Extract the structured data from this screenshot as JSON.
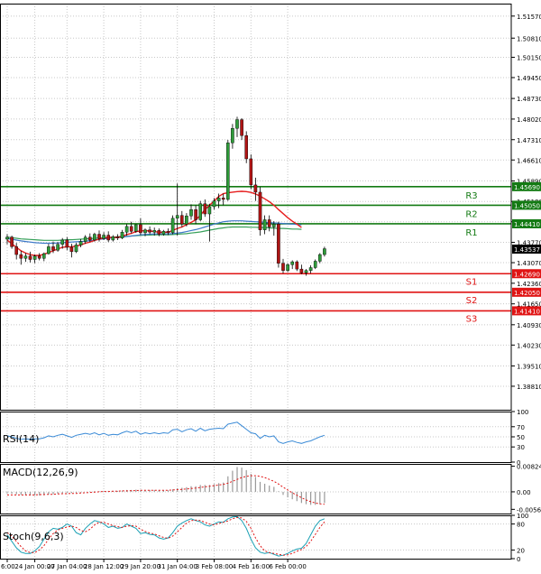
{
  "colors": {
    "background": "#ffffff",
    "grid": "#c8c8c8",
    "frame": "#000000",
    "candle_up": "#2e9c3a",
    "candle_down": "#b01414",
    "ma_fast": "#e61e1e",
    "ma_mid": "#3c78c8",
    "ma_slow": "#37a05a",
    "resistance": "#137a13",
    "support": "#e01414",
    "rsi_line": "#3a8ad6",
    "macd_hist": "#9a9a9a",
    "macd_signal": "#e01414",
    "stoch_main": "#1aa0b4",
    "stoch_signal": "#e01414",
    "price_tag": "#000000"
  },
  "chart_data": [
    {
      "type": "candlestick",
      "panel": "price",
      "ylim": [
        1.38,
        1.52
      ],
      "yticks": [
        "1.51570",
        "1.50810",
        "1.50150",
        "1.49450",
        "1.48730",
        "1.48020",
        "1.47310",
        "1.46610",
        "1.45890",
        "1.45180",
        "1.44480",
        "1.43770",
        "1.43070",
        "1.42360",
        "1.41650",
        "1.40930",
        "1.40230",
        "1.39510",
        "1.38810"
      ],
      "current_price": "1.43537",
      "candles": [
        [
          1.4388,
          1.4405,
          1.437,
          1.4395
        ],
        [
          1.4395,
          1.44,
          1.4355,
          1.4362
        ],
        [
          1.4362,
          1.4375,
          1.4318,
          1.4335
        ],
        [
          1.4335,
          1.4348,
          1.43,
          1.4322
        ],
        [
          1.4322,
          1.434,
          1.431,
          1.433
        ],
        [
          1.433,
          1.4345,
          1.4308,
          1.4318
        ],
        [
          1.4318,
          1.4335,
          1.4305,
          1.433
        ],
        [
          1.433,
          1.434,
          1.4315,
          1.4322
        ],
        [
          1.4322,
          1.4342,
          1.4312,
          1.4338
        ],
        [
          1.4338,
          1.4372,
          1.4335,
          1.4362
        ],
        [
          1.4362,
          1.438,
          1.434,
          1.435
        ],
        [
          1.435,
          1.4378,
          1.4345,
          1.437
        ],
        [
          1.437,
          1.4392,
          1.4355,
          1.4385
        ],
        [
          1.4385,
          1.4395,
          1.435,
          1.436
        ],
        [
          1.436,
          1.4372,
          1.4325,
          1.4345
        ],
        [
          1.4345,
          1.4375,
          1.434,
          1.4368
        ],
        [
          1.4368,
          1.4388,
          1.436,
          1.438
        ],
        [
          1.438,
          1.4402,
          1.4372,
          1.4395
        ],
        [
          1.4395,
          1.4408,
          1.4378,
          1.4385
        ],
        [
          1.4385,
          1.441,
          1.438,
          1.4405
        ],
        [
          1.4405,
          1.4418,
          1.438,
          1.439
        ],
        [
          1.439,
          1.4412,
          1.4385,
          1.4402
        ],
        [
          1.4402,
          1.4415,
          1.4378,
          1.4385
        ],
        [
          1.4385,
          1.4402,
          1.438,
          1.4396
        ],
        [
          1.4396,
          1.4405,
          1.4385,
          1.4392
        ],
        [
          1.4392,
          1.442,
          1.4388,
          1.4412
        ],
        [
          1.4412,
          1.444,
          1.44,
          1.4432
        ],
        [
          1.4432,
          1.4448,
          1.4408,
          1.4415
        ],
        [
          1.4415,
          1.444,
          1.441,
          1.4438
        ],
        [
          1.4438,
          1.446,
          1.4402,
          1.441
        ],
        [
          1.441,
          1.4425,
          1.4398,
          1.442
        ],
        [
          1.442,
          1.4432,
          1.4405,
          1.4412
        ],
        [
          1.4412,
          1.4428,
          1.44,
          1.4418
        ],
        [
          1.4418,
          1.4425,
          1.4398,
          1.4405
        ],
        [
          1.4405,
          1.442,
          1.44,
          1.4415
        ],
        [
          1.4415,
          1.4425,
          1.4402,
          1.441
        ],
        [
          1.441,
          1.447,
          1.4405,
          1.446
        ],
        [
          1.446,
          1.458,
          1.44,
          1.447
        ],
        [
          1.447,
          1.4485,
          1.443,
          1.444
        ],
        [
          1.444,
          1.4478,
          1.4432,
          1.4468
        ],
        [
          1.4468,
          1.4508,
          1.4455,
          1.449
        ],
        [
          1.449,
          1.4505,
          1.444,
          1.4455
        ],
        [
          1.4455,
          1.452,
          1.445,
          1.451
        ],
        [
          1.451,
          1.4525,
          1.4465,
          1.4475
        ],
        [
          1.4475,
          1.451,
          1.438,
          1.45
        ],
        [
          1.45,
          1.453,
          1.449,
          1.452
        ],
        [
          1.452,
          1.4545,
          1.4495,
          1.453
        ],
        [
          1.453,
          1.4545,
          1.4505,
          1.4525
        ],
        [
          1.4525,
          1.473,
          1.452,
          1.472
        ],
        [
          1.472,
          1.4785,
          1.47,
          1.477
        ],
        [
          1.477,
          1.481,
          1.474,
          1.48
        ],
        [
          1.48,
          1.4805,
          1.473,
          1.4745
        ],
        [
          1.4745,
          1.476,
          1.465,
          1.4665
        ],
        [
          1.4665,
          1.468,
          1.456,
          1.4575
        ],
        [
          1.4575,
          1.46,
          1.452,
          1.455
        ],
        [
          1.455,
          1.4568,
          1.44,
          1.442
        ],
        [
          1.442,
          1.447,
          1.4405,
          1.4455
        ],
        [
          1.4455,
          1.447,
          1.4415,
          1.443
        ],
        [
          1.443,
          1.445,
          1.44,
          1.444
        ],
        [
          1.444,
          1.4448,
          1.429,
          1.4305
        ],
        [
          1.4305,
          1.432,
          1.427,
          1.428
        ],
        [
          1.428,
          1.4305,
          1.4275,
          1.43
        ],
        [
          1.43,
          1.4315,
          1.4285,
          1.431
        ],
        [
          1.431,
          1.4315,
          1.4278,
          1.4285
        ],
        [
          1.4285,
          1.43,
          1.4268,
          1.4272
        ],
        [
          1.4272,
          1.4285,
          1.4262,
          1.428
        ],
        [
          1.428,
          1.4298,
          1.427,
          1.429
        ],
        [
          1.429,
          1.4318,
          1.4285,
          1.4312
        ],
        [
          1.4312,
          1.434,
          1.4305,
          1.4335
        ],
        [
          1.4335,
          1.4362,
          1.4328,
          1.4355
        ]
      ],
      "ma_fast": [
        1.4385,
        1.4372,
        1.436,
        1.4348,
        1.434,
        1.4335,
        1.4332,
        1.4332,
        1.4336,
        1.4342,
        1.4348,
        1.4354,
        1.436,
        1.4362,
        1.4362,
        1.4364,
        1.4368,
        1.4374,
        1.4378,
        1.4384,
        1.4388,
        1.4392,
        1.4394,
        1.4394,
        1.4394,
        1.4398,
        1.4404,
        1.4408,
        1.4414,
        1.4416,
        1.4418,
        1.4416,
        1.4414,
        1.4412,
        1.4412,
        1.4412,
        1.4418,
        1.4425,
        1.443,
        1.4438,
        1.4446,
        1.4455,
        1.447,
        1.449,
        1.4505,
        1.452,
        1.4535,
        1.4545,
        1.4548,
        1.455,
        1.4552,
        1.4553,
        1.4552,
        1.4549,
        1.4544,
        1.4536,
        1.4527,
        1.4517,
        1.4505,
        1.449,
        1.4476,
        1.4462,
        1.445,
        1.444,
        1.4428
      ],
      "ma_mid": [
        1.439,
        1.4388,
        1.4385,
        1.4382,
        1.438,
        1.4378,
        1.4376,
        1.4375,
        1.4374,
        1.4374,
        1.4374,
        1.4375,
        1.4376,
        1.4377,
        1.4378,
        1.4379,
        1.438,
        1.4381,
        1.4383,
        1.4385,
        1.4387,
        1.4389,
        1.4391,
        1.4393,
        1.4394,
        1.4395,
        1.4397,
        1.4399,
        1.4401,
        1.4403,
        1.4404,
        1.4405,
        1.4406,
        1.4406,
        1.4406,
        1.4406,
        1.4407,
        1.4409,
        1.4411,
        1.4414,
        1.4418,
        1.4421,
        1.4425,
        1.443,
        1.4435,
        1.444,
        1.4444,
        1.4448,
        1.445,
        1.4451,
        1.4451,
        1.4451,
        1.445,
        1.4449,
        1.4448,
        1.4447,
        1.4446,
        1.4445,
        1.4444,
        1.4443,
        1.4442,
        1.4441,
        1.444,
        1.4439,
        1.4437
      ],
      "ma_slow": [
        1.4395,
        1.4393,
        1.4391,
        1.4389,
        1.4388,
        1.4387,
        1.4386,
        1.4385,
        1.4384,
        1.4384,
        1.4384,
        1.4384,
        1.4385,
        1.4386,
        1.4386,
        1.4387,
        1.4388,
        1.4389,
        1.439,
        1.4391,
        1.4392,
        1.4393,
        1.4394,
        1.4395,
        1.4396,
        1.4397,
        1.4398,
        1.4399,
        1.44,
        1.4401,
        1.4402,
        1.4402,
        1.4403,
        1.4403,
        1.4403,
        1.4403,
        1.4404,
        1.4405,
        1.4406,
        1.4407,
        1.4409,
        1.4411,
        1.4413,
        1.4416,
        1.4419,
        1.4422,
        1.4425,
        1.4427,
        1.4429,
        1.443,
        1.443,
        1.443,
        1.443,
        1.4429,
        1.4429,
        1.4428,
        1.4428,
        1.4427,
        1.4426,
        1.4425,
        1.4425,
        1.4424,
        1.4423,
        1.4423,
        1.4422
      ],
      "levels": [
        {
          "label": "R3",
          "value": "1.45690",
          "type": "resistance"
        },
        {
          "label": "R2",
          "value": "1.45050",
          "type": "resistance"
        },
        {
          "label": "R1",
          "value": "1.44410",
          "type": "resistance"
        },
        {
          "label": "S1",
          "value": "1.42690",
          "type": "support"
        },
        {
          "label": "S2",
          "value": "1.42050",
          "type": "support"
        },
        {
          "label": "S3",
          "value": "1.41410",
          "type": "support"
        }
      ],
      "xticks": [
        {
          "label": "6:00",
          "index": 0
        },
        {
          "label": "24 Jan 00:00",
          "index": 6
        },
        {
          "label": "27 Jan 04:00",
          "index": 13
        },
        {
          "label": "28 Jan 12:00",
          "index": 21
        },
        {
          "label": "29 Jan 20:00",
          "index": 29
        },
        {
          "label": "31 Jan 04:00",
          "index": 37
        },
        {
          "label": "3 Feb 08:00",
          "index": 45
        },
        {
          "label": "4 Feb 16:00",
          "index": 53
        },
        {
          "label": "6 Feb 00:00",
          "index": 61
        }
      ]
    },
    {
      "type": "line",
      "panel": "rsi",
      "title": "RSI(14)",
      "ylim": [
        0,
        100
      ],
      "yticks": [
        "100",
        "70",
        "50",
        "30",
        "0"
      ],
      "values": [
        52,
        50,
        47,
        45,
        46,
        45,
        46,
        46,
        48,
        52,
        50,
        53,
        55,
        52,
        49,
        53,
        55,
        57,
        55,
        58,
        54,
        57,
        53,
        55,
        54,
        58,
        61,
        58,
        61,
        55,
        58,
        56,
        58,
        56,
        58,
        57,
        64,
        65,
        60,
        64,
        66,
        61,
        67,
        62,
        65,
        66,
        67,
        66,
        75,
        77,
        79,
        72,
        65,
        58,
        56,
        47,
        53,
        50,
        52,
        40,
        37,
        40,
        42,
        39,
        37,
        40,
        42,
        46,
        50,
        53
      ]
    },
    {
      "type": "bar",
      "panel": "macd",
      "title": "MACD(12,26,9)",
      "ylim": [
        -0.007,
        0.009
      ],
      "yticks": [
        "0.008248",
        "0.00",
        "-0.005647"
      ],
      "histogram": [
        -0.0005,
        -0.0006,
        -0.0008,
        -0.001,
        -0.0011,
        -0.0012,
        -0.0012,
        -0.0012,
        -0.0011,
        -0.0009,
        -0.0008,
        -0.0006,
        -0.0004,
        -0.0004,
        -0.0004,
        -0.0003,
        -0.0002,
        0.0,
        0.0001,
        0.0002,
        0.0002,
        0.0003,
        0.0003,
        0.0003,
        0.0003,
        0.0004,
        0.0006,
        0.0006,
        0.0007,
        0.0006,
        0.0006,
        0.0006,
        0.0006,
        0.0005,
        0.0005,
        0.0005,
        0.0008,
        0.0012,
        0.0013,
        0.0015,
        0.0018,
        0.0018,
        0.0022,
        0.0022,
        0.0022,
        0.0025,
        0.0028,
        0.003,
        0.005,
        0.0068,
        0.008,
        0.0078,
        0.007,
        0.0058,
        0.0048,
        0.0032,
        0.0026,
        0.002,
        0.0016,
        0.0002,
        -0.001,
        -0.0018,
        -0.0024,
        -0.003,
        -0.0036,
        -0.004,
        -0.0042,
        -0.0042,
        -0.004,
        -0.0036
      ],
      "signal": [
        -0.001,
        -0.001,
        -0.001,
        -0.001,
        -0.001,
        -0.001,
        -0.001,
        -0.0009,
        -0.0009,
        -0.0008,
        -0.0008,
        -0.0007,
        -0.0006,
        -0.0006,
        -0.0005,
        -0.0005,
        -0.0004,
        -0.0003,
        -0.0002,
        -0.0001,
        0.0,
        0.0001,
        0.0001,
        0.0002,
        0.0002,
        0.0003,
        0.0003,
        0.0004,
        0.0004,
        0.0005,
        0.0005,
        0.0005,
        0.0005,
        0.0005,
        0.0005,
        0.0005,
        0.0006,
        0.0007,
        0.0008,
        0.0009,
        0.0011,
        0.0012,
        0.0014,
        0.0016,
        0.0018,
        0.002,
        0.0022,
        0.0024,
        0.0028,
        0.0034,
        0.004,
        0.0046,
        0.005,
        0.0052,
        0.0052,
        0.005,
        0.0046,
        0.004,
        0.0034,
        0.0025,
        0.0015,
        0.0006,
        -0.0003,
        -0.0011,
        -0.0019,
        -0.0026,
        -0.0032,
        -0.0036,
        -0.0039,
        -0.004
      ]
    },
    {
      "type": "line",
      "panel": "stoch",
      "title": "Stoch(9,6,3)",
      "ylim": [
        0,
        100
      ],
      "yticks": [
        "100",
        "80",
        "20",
        "0"
      ],
      "main": [
        55,
        40,
        25,
        15,
        12,
        12,
        18,
        28,
        45,
        62,
        70,
        68,
        72,
        80,
        75,
        60,
        55,
        70,
        80,
        88,
        85,
        80,
        72,
        75,
        70,
        72,
        80,
        75,
        70,
        58,
        60,
        56,
        55,
        48,
        45,
        48,
        60,
        75,
        82,
        88,
        92,
        88,
        85,
        78,
        75,
        80,
        85,
        84,
        92,
        96,
        97,
        88,
        70,
        45,
        25,
        15,
        12,
        14,
        10,
        6,
        8,
        12,
        18,
        22,
        24,
        35,
        55,
        75,
        88,
        92
      ],
      "signal": [
        60,
        52,
        40,
        28,
        18,
        14,
        14,
        20,
        30,
        45,
        58,
        66,
        70,
        73,
        75,
        72,
        65,
        62,
        68,
        78,
        84,
        84,
        80,
        76,
        74,
        72,
        75,
        76,
        75,
        68,
        63,
        59,
        57,
        53,
        49,
        47,
        52,
        62,
        72,
        82,
        88,
        89,
        88,
        84,
        80,
        78,
        81,
        84,
        87,
        92,
        95,
        94,
        86,
        70,
        48,
        30,
        18,
        14,
        12,
        10,
        8,
        9,
        12,
        17,
        21,
        28,
        40,
        56,
        72,
        85
      ]
    }
  ]
}
